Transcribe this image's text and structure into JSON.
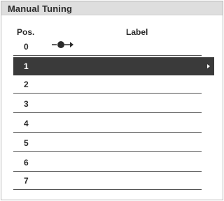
{
  "window": {
    "title": "Manual Tuning"
  },
  "columns": {
    "position": "Pos.",
    "label": "Label"
  },
  "rows": [
    {
      "pos": "0",
      "icon": "tuner-signal-icon",
      "selected": false
    },
    {
      "pos": "1",
      "selected": true
    },
    {
      "pos": "2",
      "selected": false
    },
    {
      "pos": "3",
      "selected": false
    },
    {
      "pos": "4",
      "selected": false
    },
    {
      "pos": "5",
      "selected": false
    },
    {
      "pos": "6",
      "selected": false
    },
    {
      "pos": "7",
      "selected": false
    }
  ],
  "colors": {
    "title_bar": "#dedede",
    "selected_row": "#3a3a3a",
    "divider": "#555555"
  }
}
